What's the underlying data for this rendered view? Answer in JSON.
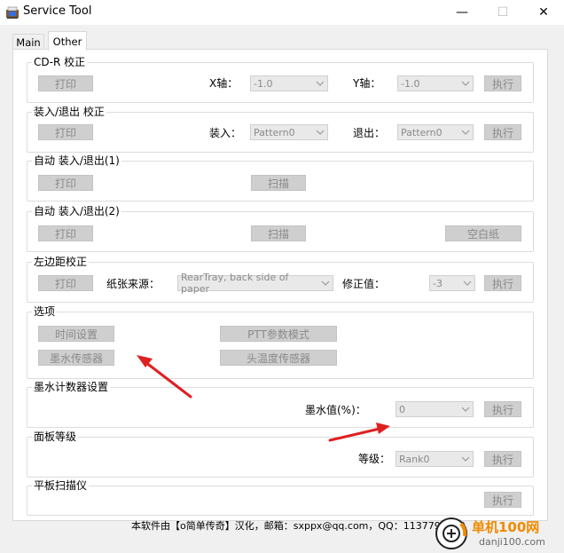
{
  "window": {
    "title": "Service Tool",
    "controls": {
      "minimize": "—",
      "maximize": "☐",
      "close": "✕"
    }
  },
  "tabs": [
    {
      "label": "Main"
    },
    {
      "label": "Other",
      "active": true
    }
  ],
  "groups": {
    "cdr": {
      "title": "CD-R 校正",
      "print": "打印",
      "x_label": "X轴：",
      "x_value": "-1.0",
      "y_label": "Y轴：",
      "y_value": "-1.0",
      "execute": "执行"
    },
    "loadeject": {
      "title": "装入/退出 校正",
      "print": "打印",
      "load_label": "装入：",
      "load_value": "Pattern0",
      "eject_label": "退出：",
      "eject_value": "Pattern0",
      "execute": "执行"
    },
    "auto1": {
      "title": "自动 装入/退出(1)",
      "print": "打印",
      "scan": "扫描"
    },
    "auto2": {
      "title": "自动 装入/退出(2)",
      "print": "打印",
      "scan": "扫描",
      "blank": "空白纸"
    },
    "leftmargin": {
      "title": "左边距校正",
      "print": "打印",
      "source_label": "纸张来源：",
      "source_value": "RearTray, back side of paper",
      "correction_label": "修正值：",
      "correction_value": "-3",
      "execute": "执行"
    },
    "options": {
      "title": "选项",
      "time_setting": "时间设置",
      "ptt_mode": "PTT参数模式",
      "ink_sensor": "墨水传感器",
      "head_temp_sensor": "头温度传感器"
    },
    "ink_counter": {
      "title": "墨水计数器设置",
      "value_label": "墨水值(%)：",
      "value": "0",
      "execute": "执行"
    },
    "panel_level": {
      "title": "面板等级",
      "level_label": "等级：",
      "level_value": "Rank0",
      "execute": "执行"
    },
    "flatbed": {
      "title": "平板扫描仪",
      "execute": "执行"
    }
  },
  "footer": {
    "text": "本软件由【o简单传奇】汉化，邮箱：sxppx@qq.com，QQ：1137798333"
  },
  "watermark": {
    "site": "单机100网",
    "url": "danji100.com"
  },
  "colors": {
    "arrow": "#e02020",
    "watermark_orange": "#f08a00"
  }
}
